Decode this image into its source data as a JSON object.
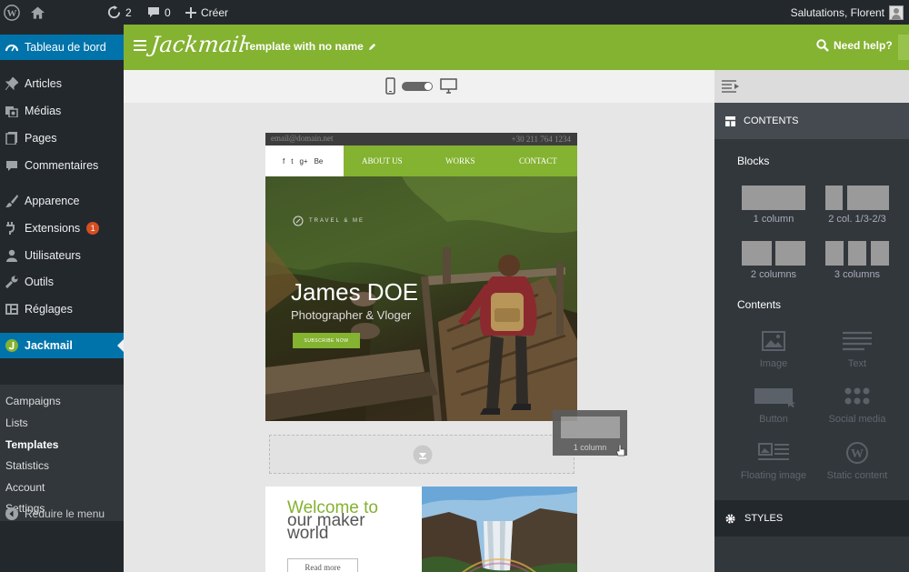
{
  "admin_bar": {
    "updates_count": "2",
    "comments_count": "0",
    "create_label": "Créer",
    "greeting": "Salutations, Florent"
  },
  "sidebar": {
    "dashboard": "Tableau de bord",
    "items": [
      "Articles",
      "Médias",
      "Pages",
      "Commentaires",
      "Apparence",
      "Extensions",
      "Utilisateurs",
      "Outils",
      "Réglages"
    ],
    "extensions_badge": "1",
    "plugin": "Jackmail",
    "submenu": [
      "Campaigns",
      "Lists",
      "Templates",
      "Statistics",
      "Account",
      "Settings"
    ],
    "collapse": "Réduire le menu"
  },
  "header": {
    "logo": "Jackmail",
    "template_name": "Template with no name",
    "help": "Need help?"
  },
  "email": {
    "email_address": "email@domain.net",
    "phone": "+30 211 764 1234",
    "social": [
      "f",
      "t",
      "g+",
      "Be"
    ],
    "nav": [
      "ABOUT US",
      "WORKS",
      "CONTACT"
    ],
    "travel": "TRAVEL & ME",
    "hero_title": "James DOE",
    "hero_subtitle": "Photographer & Vloger",
    "subscribe": "SUBSCRIBE NOW",
    "welcome_line1": "Welcome to",
    "welcome_line2": "our maker",
    "welcome_line3": "world",
    "read_more": "Read more",
    "drag_label": "1 column"
  },
  "panel": {
    "contents_tab": "CONTENTS",
    "blocks_title": "Blocks",
    "blocks": [
      "1 column",
      "2 col. 1/3-2/3",
      "2 columns",
      "3 columns"
    ],
    "contents_title": "Contents",
    "contents": [
      "Image",
      "Text",
      "Button",
      "Social media",
      "Floating image",
      "Static content"
    ],
    "styles_tab": "STYLES"
  },
  "colors": {
    "accent": "#84b231",
    "wp_blue": "#0073aa",
    "wp_dark": "#23282d"
  }
}
